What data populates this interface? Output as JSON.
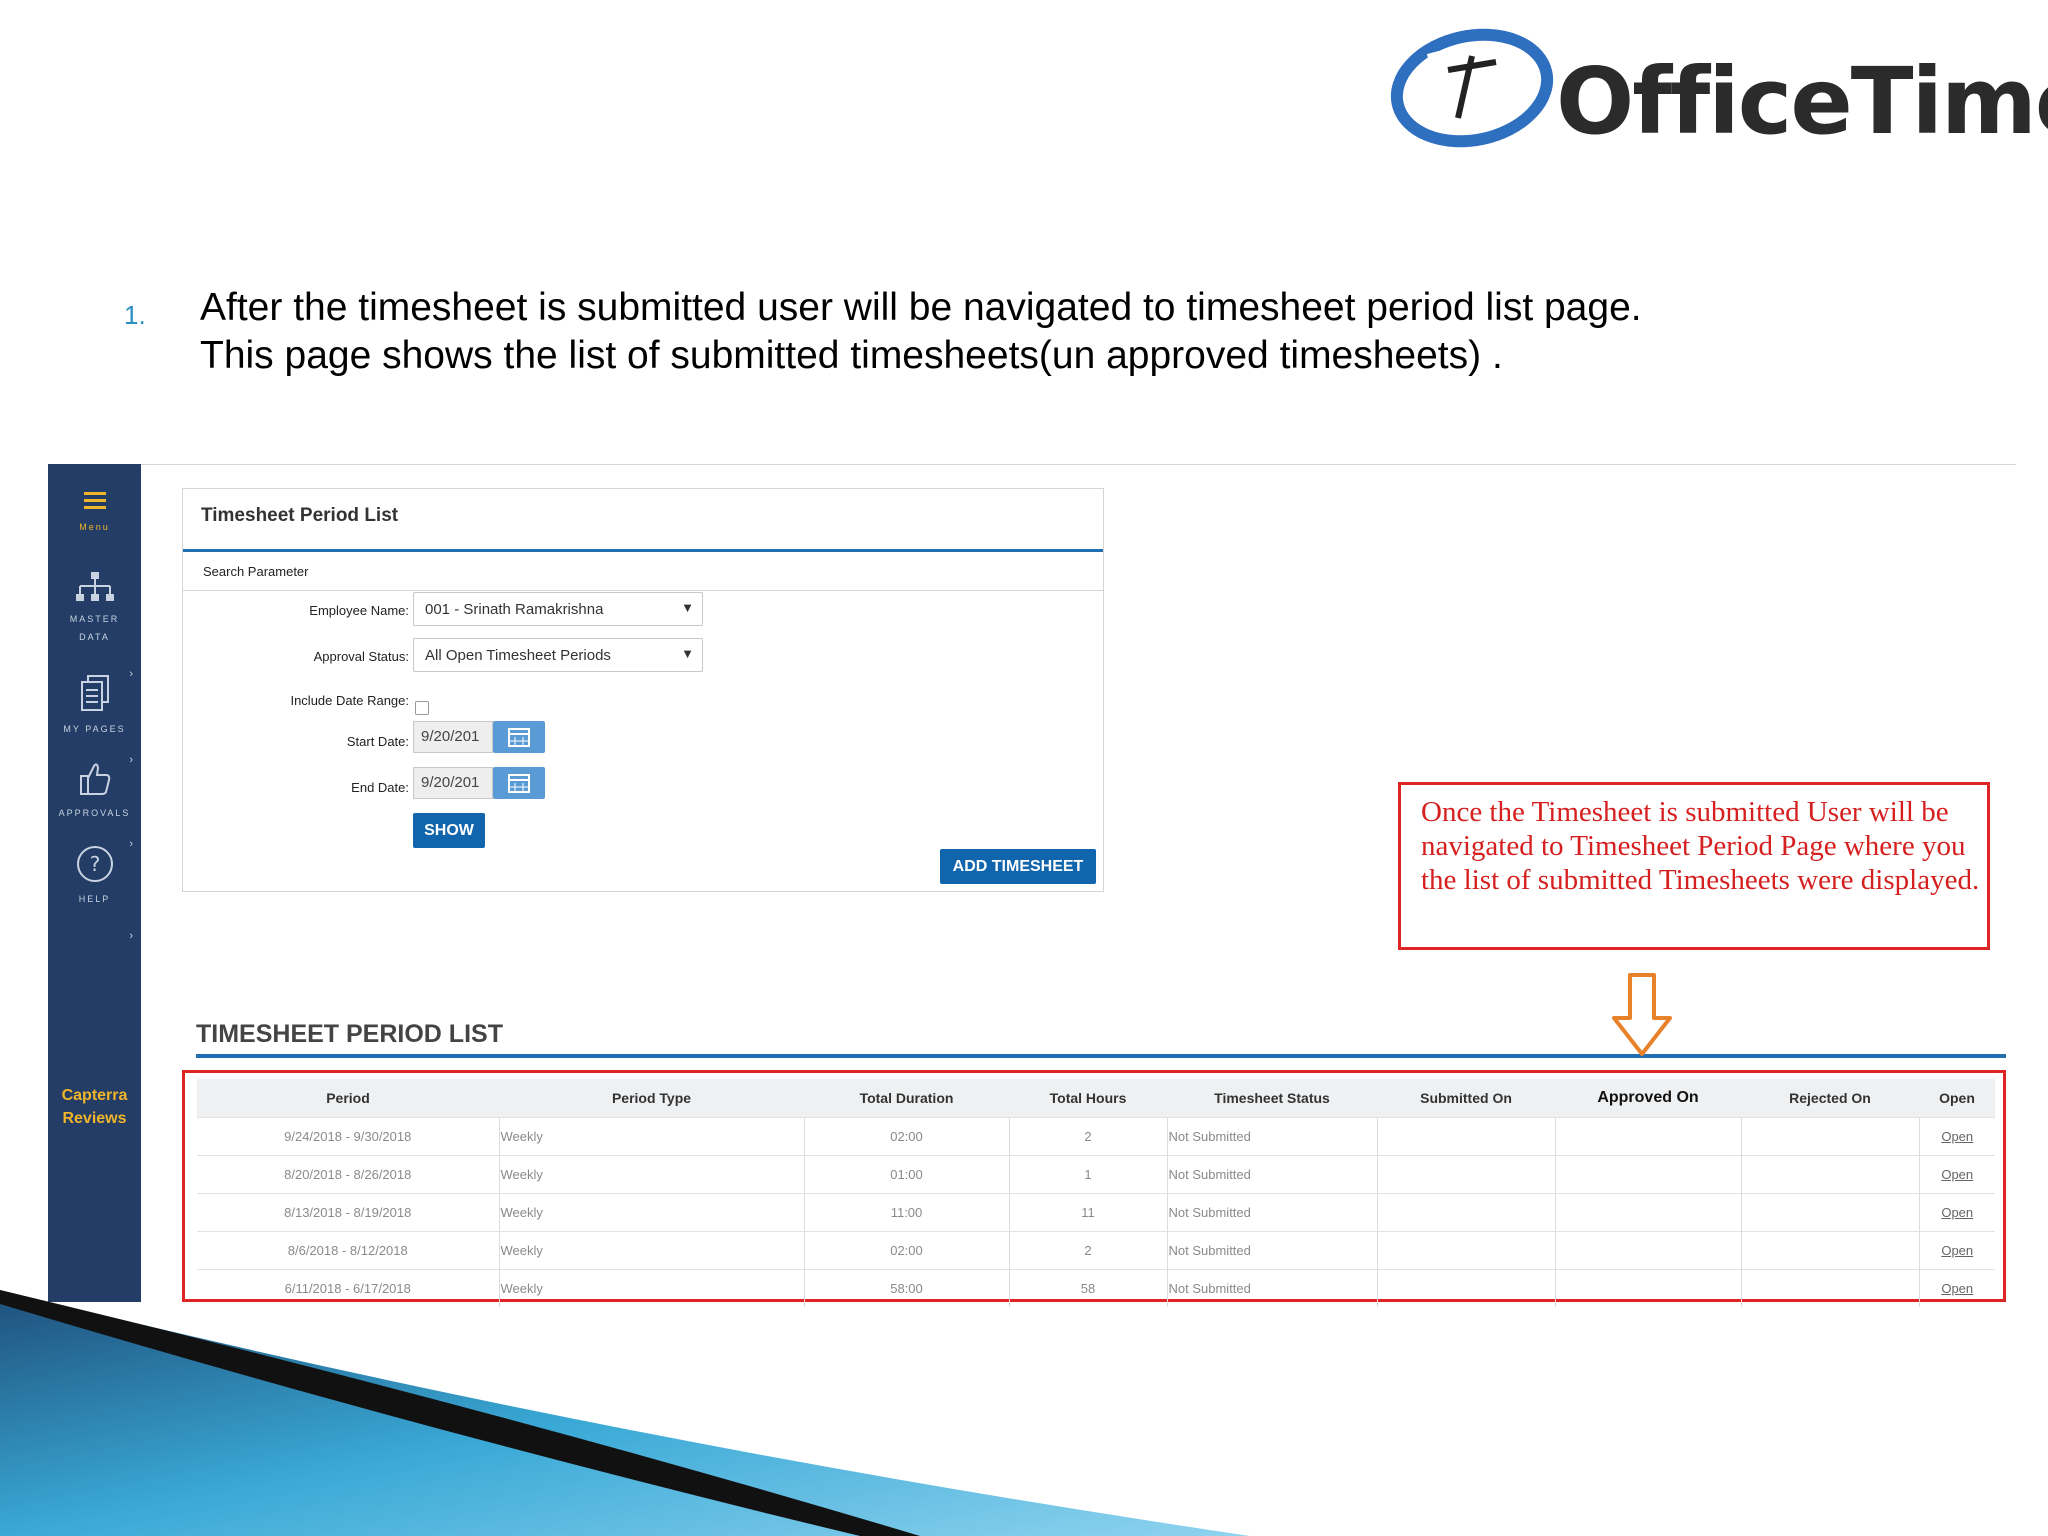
{
  "logo": {
    "text": "OfficeTimer"
  },
  "intro": {
    "number": "1.",
    "line1": "After the timesheet is submitted user will be navigated to timesheet period list page.",
    "line2": "This page shows the list of submitted timesheets(un approved timesheets) ."
  },
  "sidebar": {
    "menu_label": "Menu",
    "items": [
      {
        "label_line1": "MASTER",
        "label_line2": "DATA",
        "icon": "sitemap-icon"
      },
      {
        "label": "MY PAGES",
        "icon": "documents-icon"
      },
      {
        "label": "APPROVALS",
        "icon": "thumbs-up-icon"
      },
      {
        "label": "HELP",
        "icon": "help-circle-icon"
      }
    ],
    "capterra_line1": "Capterra",
    "capterra_line2": "Reviews"
  },
  "panel": {
    "title": "Timesheet Period List",
    "subtitle": "Search Parameter",
    "employee_label": "Employee Name:",
    "employee_value": "001 - Srinath Ramakrishna",
    "approval_label": "Approval Status:",
    "approval_value": "All Open Timesheet Periods",
    "include_label": "Include Date Range:",
    "start_label": "Start Date:",
    "start_value": "9/20/201",
    "end_label": "End Date:",
    "end_value": "9/20/201",
    "show_button": "SHOW",
    "add_button": "ADD TIMESHEET"
  },
  "list": {
    "title": "TIMESHEET PERIOD LIST",
    "columns": [
      "Period",
      "Period Type",
      "Total Duration",
      "Total Hours",
      "Timesheet Status",
      "Submitted On",
      "Approved On",
      "Rejected On",
      "Open"
    ],
    "rows": [
      {
        "period": "9/24/2018 - 9/30/2018",
        "type": "Weekly",
        "duration": "02:00",
        "hours": "2",
        "status": "Not Submitted",
        "submitted": "",
        "approved": "",
        "rejected": "",
        "open": "Open"
      },
      {
        "period": "8/20/2018 - 8/26/2018",
        "type": "Weekly",
        "duration": "01:00",
        "hours": "1",
        "status": "Not Submitted",
        "submitted": "",
        "approved": "",
        "rejected": "",
        "open": "Open"
      },
      {
        "period": "8/13/2018 - 8/19/2018",
        "type": "Weekly",
        "duration": "11:00",
        "hours": "11",
        "status": "Not Submitted",
        "submitted": "",
        "approved": "",
        "rejected": "",
        "open": "Open"
      },
      {
        "period": "8/6/2018 - 8/12/2018",
        "type": "Weekly",
        "duration": "02:00",
        "hours": "2",
        "status": "Not Submitted",
        "submitted": "",
        "approved": "",
        "rejected": "",
        "open": "Open"
      },
      {
        "period": "6/11/2018 - 6/17/2018",
        "type": "Weekly",
        "duration": "58:00",
        "hours": "58",
        "status": "Not Submitted",
        "submitted": "",
        "approved": "",
        "rejected": "",
        "open": "Open"
      }
    ]
  },
  "callout": {
    "text": "Once the Timesheet is submitted User will be navigated to Timesheet Period Page where you the list of submitted Timesheets were displayed."
  },
  "colors": {
    "accent": "#1f6fb2",
    "sidebar": "#233d66",
    "highlight": "#e02424",
    "arrow": "#e8822a"
  }
}
